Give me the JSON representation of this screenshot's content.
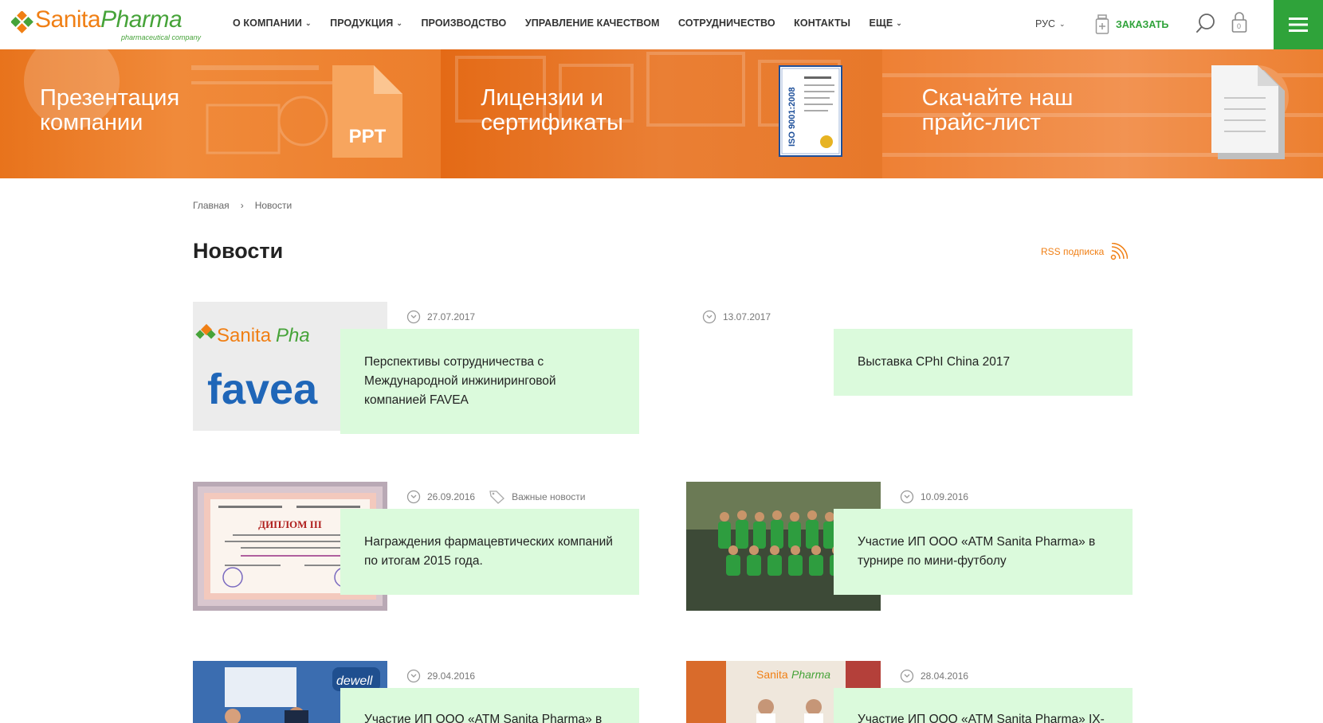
{
  "header": {
    "logo_sanita": "Sanita",
    "logo_pharma": "Pharma",
    "logo_sub": "pharmaceutical company",
    "nav": [
      {
        "label": "О КОМПАНИИ",
        "dropdown": true
      },
      {
        "label": "ПРОДУКЦИЯ",
        "dropdown": true
      },
      {
        "label": "ПРОИЗВОДСТВО",
        "dropdown": false
      },
      {
        "label": "УПРАВЛЕНИЕ КАЧЕСТВОМ",
        "dropdown": false
      },
      {
        "label": "СОТРУДНИЧЕСТВО",
        "dropdown": false
      },
      {
        "label": "КОНТАКТЫ",
        "dropdown": false
      },
      {
        "label": "ЕЩЕ",
        "dropdown": true
      }
    ],
    "lang": "РУС",
    "order_label": "ЗАКАЗАТЬ",
    "cart_count": "0",
    "accent_green": "#2fa33a",
    "accent_orange": "#f07f14"
  },
  "banner": [
    {
      "title": "Презентация\nкомпании",
      "icon": "ppt-file-icon",
      "icon_label": "PPT"
    },
    {
      "title": "Лицензии и\nсертификаты",
      "icon": "certificate-icon",
      "icon_label": "ISO 9001:2008"
    },
    {
      "title": "Скачайте наш\nпрайс-лист",
      "icon": "document-icon"
    }
  ],
  "breadcrumb": {
    "home": "Главная",
    "current": "Новости"
  },
  "page": {
    "title": "Новости",
    "rss_label": "RSS подписка"
  },
  "news": [
    {
      "date": "27.07.2017",
      "title": "Перспективы сотрудничества с Международной инжиниринговой компанией FAVEA",
      "thumb_text": "favea"
    },
    {
      "date": "13.07.2017",
      "title": "Выставка CPhI China 2017"
    },
    {
      "date": "26.09.2016",
      "category": "Важные новости",
      "title": "Награждения фармацевтических компаний по итогам 2015 года.",
      "thumb_text": "ДИПЛОМ III"
    },
    {
      "date": "10.09.2016",
      "title": "Участие ИП ООО «ATM Sanita Pharma» в турнире по мини-футболу"
    },
    {
      "date": "29.04.2016",
      "title": "Участие ИП ООО «ATM Sanita Pharma» в"
    },
    {
      "date": "28.04.2016",
      "title": "Участие ИП ООО «ATM Sanita Pharma» IX-"
    }
  ]
}
